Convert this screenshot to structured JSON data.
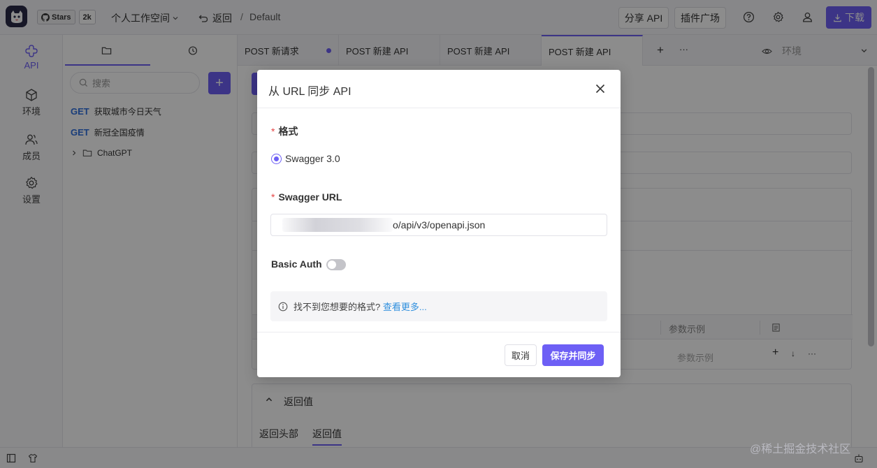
{
  "header": {
    "github_stars_label": "Stars",
    "github_stars_count": "2k",
    "workspace": "个人工作空间",
    "back_label": "返回",
    "breadcrumb_sep": "/",
    "breadcrumb": "Default",
    "share_api": "分享 API",
    "plugin_market": "插件广场",
    "download": "下载"
  },
  "sidenav": {
    "items": [
      {
        "label": "API",
        "icon": "api-icon"
      },
      {
        "label": "环境",
        "icon": "cube-icon"
      },
      {
        "label": "成员",
        "icon": "members-icon"
      },
      {
        "label": "设置",
        "icon": "gear-icon"
      }
    ]
  },
  "tree": {
    "search_placeholder": "搜索",
    "add_label": "+",
    "apis": [
      {
        "method": "GET",
        "name": "获取城市今日天气"
      },
      {
        "method": "GET",
        "name": "新冠全国疫情"
      }
    ],
    "folder": "ChatGPT"
  },
  "tabs": {
    "items": [
      {
        "label": "POST 新请求"
      },
      {
        "label": "POST 新建 API"
      },
      {
        "label": "POST 新建 API"
      },
      {
        "label": "POST 新建 API"
      }
    ],
    "add_label": "+",
    "more_label": "···",
    "env_label": "环境"
  },
  "main": {
    "param_example_header": "参数示例",
    "param_example_placeholder": "参数示例",
    "return_section": "返回值",
    "return_tabs": [
      "返回头部",
      "返回值"
    ]
  },
  "modal": {
    "title": "从 URL 同步 API",
    "format_label": "格式",
    "format_option": "Swagger 3.0",
    "url_label": "Swagger URL",
    "url_value": "o/api/v3/openapi.json",
    "basic_auth_label": "Basic Auth",
    "basic_auth_enabled": false,
    "info_text": "找不到您想要的格式?",
    "info_link": "查看更多...",
    "cancel": "取消",
    "save": "保存并同步"
  },
  "watermark": "@稀土掘金技术社区",
  "colors": {
    "primary": "#6d5ff5",
    "get_method": "#2f6fde",
    "link": "#2f8fde",
    "required": "#e54545"
  }
}
